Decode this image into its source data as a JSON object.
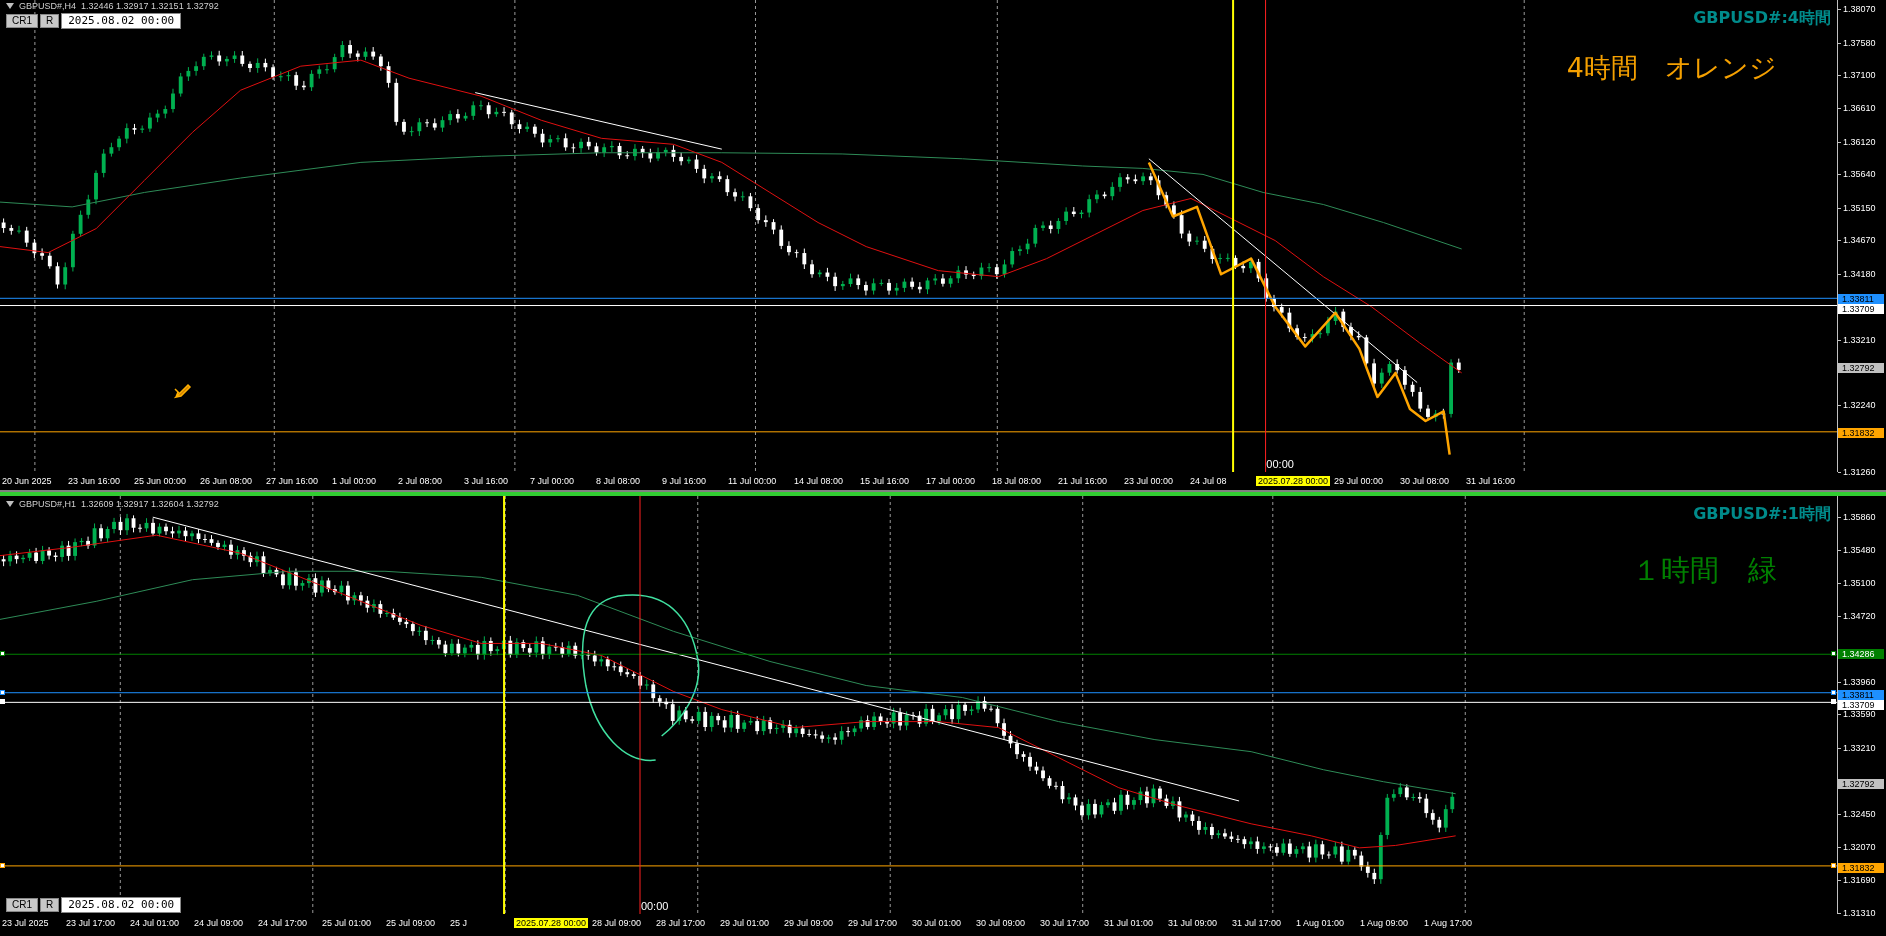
{
  "panels": [
    {
      "kind": "h4",
      "symbol": "GBPUSD#,H4",
      "ohlc": [
        "1.32446",
        "1.32917",
        "1.32151",
        "1.32792"
      ],
      "title": "GBPUSD#:4時間",
      "note": "4時間　オレンジ",
      "buttons": [
        "CR1",
        "R"
      ],
      "date": "2025.08.02 00:00",
      "cursor_time": "00:00",
      "price_ticks": [
        "1.38070",
        "1.37580",
        "1.37100",
        "1.36610",
        "1.36120",
        "1.35640",
        "1.35150",
        "1.34670",
        "1.34180",
        "1.33210",
        "1.32240",
        "1.31260"
      ],
      "price_markers": [
        {
          "text": "1.33811",
          "color": "#1e90ff"
        },
        {
          "text": "1.33709",
          "color": "#ffffff"
        },
        {
          "text": "1.32792",
          "color": "#c0c0c0"
        },
        {
          "text": "1.31832",
          "color": "#ffa500"
        }
      ],
      "time_ticks": [
        {
          "text": "20 Jun 2025",
          "kind": "tick"
        },
        {
          "text": "23 Jun 16:00",
          "kind": "tick"
        },
        {
          "text": "25 Jun 00:00",
          "kind": "tick"
        },
        {
          "text": "26 Jun 08:00",
          "kind": "tick"
        },
        {
          "text": "27 Jun 16:00",
          "kind": "tick"
        },
        {
          "text": "1 Jul 00:00",
          "kind": "tick"
        },
        {
          "text": "2 Jul 08:00",
          "kind": "tick"
        },
        {
          "text": "3 Jul 16:00",
          "kind": "tick"
        },
        {
          "text": "7 Jul 00:00",
          "kind": "tick"
        },
        {
          "text": "8 Jul 08:00",
          "kind": "tick"
        },
        {
          "text": "9 Jul 16:00",
          "kind": "tick"
        },
        {
          "text": "11 Jul 00:00",
          "kind": "tick"
        },
        {
          "text": "14 Jul 08:00",
          "kind": "tick"
        },
        {
          "text": "15 Jul 16:00",
          "kind": "tick"
        },
        {
          "text": "17 Jul 00:00",
          "kind": "tick"
        },
        {
          "text": "18 Jul 08:00",
          "kind": "tick"
        },
        {
          "text": "21 Jul 16:00",
          "kind": "tick"
        },
        {
          "text": "23 Jul 00:00",
          "kind": "tick"
        },
        {
          "text": "24 Jul 08",
          "kind": "tick"
        },
        {
          "text": "2025.07.28 00:00",
          "kind": "marker"
        },
        {
          "text": "29 Jul 00:00",
          "kind": "tick"
        },
        {
          "text": "30 Jul 08:00",
          "kind": "tick"
        },
        {
          "text": "31 Jul 16:00",
          "kind": "tick"
        }
      ]
    },
    {
      "kind": "h1",
      "symbol": "GBPUSD#,H1",
      "ohlc": [
        "1.32609",
        "1.32917",
        "1.32604",
        "1.32792"
      ],
      "title": "GBPUSD#:1時間",
      "note": "１時間　緑",
      "buttons": [
        "CR1",
        "R"
      ],
      "date": "2025.08.02 00:00",
      "cursor_time": "00:00",
      "price_ticks": [
        "1.35860",
        "1.35480",
        "1.35100",
        "1.34720",
        "1.33960",
        "1.33590",
        "1.33210",
        "1.32450",
        "1.32070",
        "1.31690",
        "1.31310"
      ],
      "price_markers": [
        {
          "text": "1.34286",
          "color": "#008000"
        },
        {
          "text": "1.33811",
          "color": "#1e90ff"
        },
        {
          "text": "1.33709",
          "color": "#ffffff"
        },
        {
          "text": "1.32792",
          "color": "#c0c0c0"
        },
        {
          "text": "1.31832",
          "color": "#ffa500"
        }
      ],
      "time_ticks": [
        {
          "text": "23 Jul 2025",
          "kind": "tick"
        },
        {
          "text": "23 Jul 17:00",
          "kind": "tick"
        },
        {
          "text": "24 Jul 01:00",
          "kind": "tick"
        },
        {
          "text": "24 Jul 09:00",
          "kind": "tick"
        },
        {
          "text": "24 Jul 17:00",
          "kind": "tick"
        },
        {
          "text": "25 Jul 01:00",
          "kind": "tick"
        },
        {
          "text": "25 Jul 09:00",
          "kind": "tick"
        },
        {
          "text": "25 J",
          "kind": "tick"
        },
        {
          "text": "2025.07.28 00:00",
          "kind": "marker"
        },
        {
          "text": "28 Jul 09:00",
          "kind": "tick"
        },
        {
          "text": "28 Jul 17:00",
          "kind": "tick"
        },
        {
          "text": "29 Jul 01:00",
          "kind": "tick"
        },
        {
          "text": "29 Jul 09:00",
          "kind": "tick"
        },
        {
          "text": "29 Jul 17:00",
          "kind": "tick"
        },
        {
          "text": "30 Jul 01:00",
          "kind": "tick"
        },
        {
          "text": "30 Jul 09:00",
          "kind": "tick"
        },
        {
          "text": "30 Jul 17:00",
          "kind": "tick"
        },
        {
          "text": "31 Jul 01:00",
          "kind": "tick"
        },
        {
          "text": "31 Jul 09:00",
          "kind": "tick"
        },
        {
          "text": "31 Jul 17:00",
          "kind": "tick"
        },
        {
          "text": "1 Aug 01:00",
          "kind": "tick"
        },
        {
          "text": "1 Aug 09:00",
          "kind": "tick"
        },
        {
          "text": "1 Aug 17:00",
          "kind": "tick"
        }
      ]
    }
  ]
}
